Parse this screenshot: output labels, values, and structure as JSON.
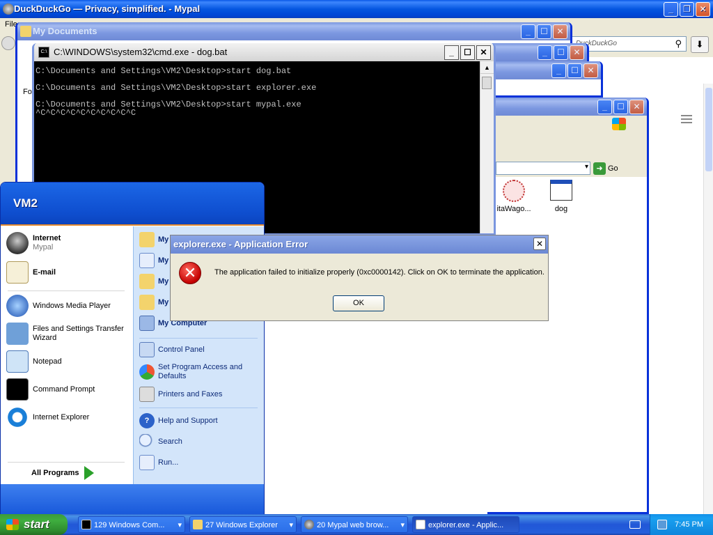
{
  "browser": {
    "title": "DuckDuckGo — Privacy, simplified. - Mypal",
    "menu_first": "File",
    "search_placeholder": "DuckDuckGo"
  },
  "mydocs": {
    "title": "My Documents",
    "left_label": "Fo"
  },
  "explorer": {
    "go_label": "Go",
    "files": [
      {
        "label": "itaWago..."
      },
      {
        "label": "dog"
      }
    ]
  },
  "cmd": {
    "title": "C:\\WINDOWS\\system32\\cmd.exe - dog.bat",
    "lines": [
      "C:\\Documents and Settings\\VM2\\Desktop>start dog.bat",
      "",
      "C:\\Documents and Settings\\VM2\\Desktop>start explorer.exe",
      "",
      "C:\\Documents and Settings\\VM2\\Desktop>start mypal.exe",
      "^C^C^C^C^C^C^C^C^C^C"
    ]
  },
  "start_menu": {
    "user": "VM2",
    "left": [
      {
        "label": "Internet",
        "sub": "Mypal",
        "icon": "mypal-icon"
      },
      {
        "label": "E-mail",
        "sub": "",
        "icon": "email-icon"
      },
      {
        "label": "Windows Media Player",
        "icon": "media-player-icon"
      },
      {
        "label": "Files and Settings Transfer Wizard",
        "icon": "transfer-wizard-icon"
      },
      {
        "label": "Notepad",
        "icon": "notepad-icon"
      },
      {
        "label": "Command Prompt",
        "icon": "command-prompt-icon"
      },
      {
        "label": "Internet Explorer",
        "icon": "internet-explorer-icon"
      }
    ],
    "all_programs": "All Programs",
    "right": [
      {
        "label": "My",
        "icon": "my-documents-icon"
      },
      {
        "label": "My",
        "icon": "my-recent-documents-icon"
      },
      {
        "label": "My",
        "icon": "my-pictures-icon"
      },
      {
        "label": "My",
        "icon": "my-music-icon"
      },
      {
        "label": "My Computer",
        "icon": "my-computer-icon"
      },
      {
        "label": "Control Panel",
        "icon": "control-panel-icon"
      },
      {
        "label": "Set Program Access and Defaults",
        "icon": "program-access-icon"
      },
      {
        "label": "Printers and Faxes",
        "icon": "printers-icon"
      },
      {
        "label": "Help and Support",
        "icon": "help-icon"
      },
      {
        "label": "Search",
        "icon": "search-icon"
      },
      {
        "label": "Run...",
        "icon": "run-icon"
      }
    ]
  },
  "dialog": {
    "title": "explorer.exe - Application Error",
    "message": "The application failed to initialize properly (0xc0000142). Click on OK to terminate the application.",
    "ok": "OK",
    "icon": "error-icon"
  },
  "taskbar": {
    "start": "start",
    "tasks": [
      {
        "label": "129 Windows Com...",
        "icon": "cmd-icon"
      },
      {
        "label": "27 Windows Explorer",
        "icon": "folder-icon"
      },
      {
        "label": "20 Mypal web brow...",
        "icon": "mypal-icon"
      },
      {
        "label": "explorer.exe - Applic...",
        "icon": "window-icon"
      }
    ],
    "clock": "7:45 PM"
  }
}
